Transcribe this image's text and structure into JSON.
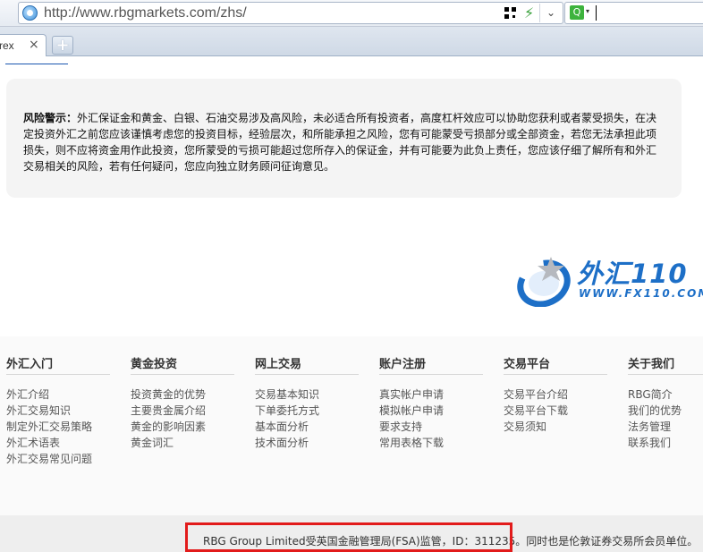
{
  "browser": {
    "url": "http://www.rbgmarkets.com/zhs/",
    "tab_label": "rex",
    "tab_close": "×",
    "new_tab": "+",
    "dropdown": "⌄",
    "search_icon_glyph": "Q",
    "search_caret": "▾",
    "icons": [
      "globe-icon",
      "qr-code-icon",
      "lightning-icon",
      "search-engine-icon"
    ]
  },
  "warning": {
    "label": "风险警示：",
    "text": "外汇保证金和黄金、白银、石油交易涉及高风险，未必适合所有投资者，高度杠杆效应可以协助您获利或者蒙受损失，在决定投资外汇之前您应该谨慎考虑您的投资目标，经验层次，和所能承担之风险，您有可能蒙受亏损部分或全部资金，若您无法承担此项损失，则不应将资金用作此投资，您所蒙受的亏损可能超过您所存入的保证金，并有可能要为此负上责任，您应该仔细了解所有和外汇交易相关的风险，若有任何疑问，您应向独立财务顾问征询意见。"
  },
  "watermark": {
    "title": "外汇110",
    "subtitle": "WWW.FX110.COM"
  },
  "footer": {
    "columns": [
      {
        "heading": "外汇入门",
        "links": [
          "外汇介绍",
          "外汇交易知识",
          "制定外汇交易策略",
          "外汇术语表",
          "外汇交易常见问题"
        ]
      },
      {
        "heading": "黄金投资",
        "links": [
          "投资黄金的优势",
          "主要贵金属介绍",
          "黄金的影响因素",
          "黄金词汇"
        ]
      },
      {
        "heading": "网上交易",
        "links": [
          "交易基本知识",
          "下单委托方式",
          "基本面分析",
          "技术面分析"
        ]
      },
      {
        "heading": "账户注册",
        "links": [
          "真实帐户申请",
          "模拟帐户申请",
          "要求支持",
          "常用表格下载"
        ]
      },
      {
        "heading": "交易平台",
        "links": [
          "交易平台介绍",
          "交易平台下载",
          "交易须知"
        ]
      },
      {
        "heading": "关于我们",
        "links": [
          "RBG简介",
          "我们的优势",
          "法务管理",
          "联系我们"
        ]
      }
    ],
    "copyright": "RBG Group Limited受英国金融管理局(FSA)监管，ID：311235。同时也是伦敦证券交易所会员单位。"
  }
}
